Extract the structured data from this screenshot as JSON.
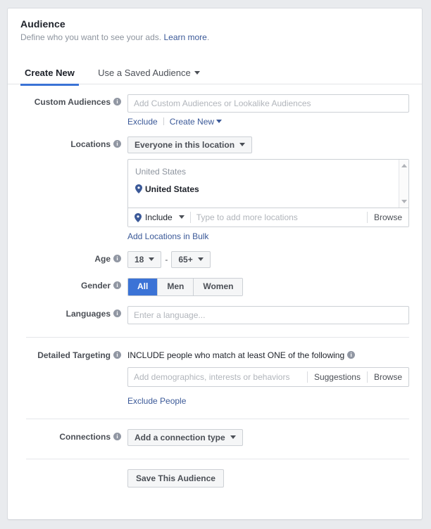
{
  "header": {
    "title": "Audience",
    "subtitle": "Define who you want to see your ads.",
    "learn_more": "Learn more",
    "period": "."
  },
  "tabs": [
    {
      "label": "Create New",
      "active": true
    },
    {
      "label": "Use a Saved Audience",
      "active": false
    }
  ],
  "custom_audiences": {
    "label": "Custom Audiences",
    "placeholder": "Add Custom Audiences or Lookalike Audiences",
    "value": "",
    "exclude_link": "Exclude",
    "create_new_link": "Create New"
  },
  "locations": {
    "label": "Locations",
    "scope_button": "Everyone in this location",
    "group_label": "United States",
    "selected": [
      {
        "name": "United States",
        "icon": "map-pin-icon"
      }
    ],
    "include_label": "Include",
    "typer_placeholder": "Type to add more locations",
    "typer_value": "",
    "browse_label": "Browse",
    "bulk_link": "Add Locations in Bulk"
  },
  "age": {
    "label": "Age",
    "min": "18",
    "max": "65+",
    "separator": "-"
  },
  "gender": {
    "label": "Gender",
    "options": [
      {
        "label": "All",
        "selected": true
      },
      {
        "label": "Men",
        "selected": false
      },
      {
        "label": "Women",
        "selected": false
      }
    ]
  },
  "languages": {
    "label": "Languages",
    "placeholder": "Enter a language...",
    "value": ""
  },
  "detailed_targeting": {
    "label": "Detailed Targeting",
    "include_title": "INCLUDE people who match at least ONE of the following",
    "placeholder": "Add demographics, interests or behaviors",
    "value": "",
    "suggestions_label": "Suggestions",
    "browse_label": "Browse",
    "exclude_link": "Exclude People"
  },
  "connections": {
    "label": "Connections",
    "button": "Add a connection type"
  },
  "footer": {
    "save_button": "Save This Audience"
  },
  "colors": {
    "accent_blue": "#3b73d6",
    "link_blue": "#3b5998",
    "page_bg": "#e9ebee",
    "card_bg": "#ffffff",
    "border": "#ccd0d5",
    "muted_text": "#8d949e"
  },
  "icons": {
    "info": "i",
    "map_pin": "map-pin-icon",
    "caret_down": "chevron-down-icon"
  }
}
